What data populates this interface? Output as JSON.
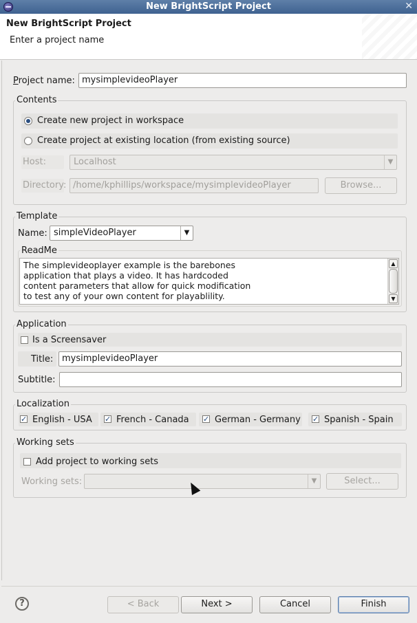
{
  "window": {
    "title": "New BrightScript Project"
  },
  "header": {
    "title": "New BrightScript Project",
    "description": "Enter a project name"
  },
  "project": {
    "label": "Project name:",
    "value": "mysimplevideoPlayer"
  },
  "contents": {
    "title": "Contents",
    "option_new": "Create new project in workspace",
    "option_existing": "Create project at existing location (from existing source)",
    "selected": "new",
    "host_label": "Host:",
    "host_value": "Localhost",
    "directory_label": "Directory:",
    "directory_value": "/home/kphillips/workspace/mysimplevideoPlayer",
    "browse_label": "Browse..."
  },
  "template": {
    "title": "Template",
    "name_label": "Name:",
    "name_value": "simpleVideoPlayer",
    "readme_title": "ReadMe",
    "readme_text": "The simplevideoplayer example is the barebones\napplication that plays a video. It has hardcoded\ncontent parameters that allow for quick modification\nto test any of your own content for playablility."
  },
  "application": {
    "title": "Application",
    "screensaver_label": "Is a Screensaver",
    "screensaver_checked": false,
    "title_label": "Title:",
    "title_value": "mysimplevideoPlayer",
    "subtitle_label": "Subtitle:",
    "subtitle_value": ""
  },
  "localization": {
    "title": "Localization",
    "items": [
      {
        "label": "English - USA",
        "checked": true
      },
      {
        "label": "French - Canada",
        "checked": true
      },
      {
        "label": "German - Germany",
        "checked": true
      },
      {
        "label": "Spanish - Spain",
        "checked": true
      }
    ]
  },
  "working_sets": {
    "title": "Working sets",
    "add_label": "Add project to working sets",
    "add_checked": false,
    "sets_label": "Working sets:",
    "select_label": "Select..."
  },
  "footer": {
    "help": "?",
    "back_label": "< Back",
    "next_label": "Next >",
    "cancel_label": "Cancel",
    "finish_label": "Finish"
  },
  "icons": [
    "eclipse-icon",
    "close-icon",
    "radio-icon",
    "checkbox-icon",
    "chevron-down-icon",
    "help-icon",
    "mouse-cursor-icon"
  ]
}
